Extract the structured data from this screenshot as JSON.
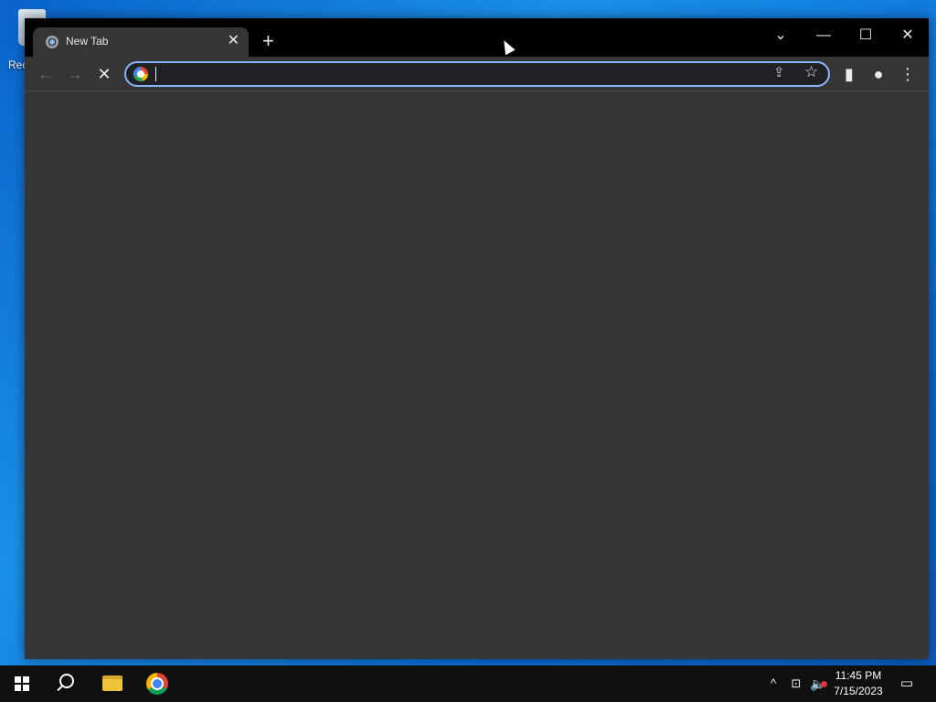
{
  "desktop": {
    "icons": [
      {
        "label": "Rec",
        "icon": "recycle-bin-icon"
      }
    ]
  },
  "browser": {
    "tabs": [
      {
        "title": "New Tab",
        "active": true,
        "icon": "chrome-newtab-icon"
      }
    ],
    "new_tab_symbol": "+",
    "window_controls": {
      "tab_search": "⌄",
      "minimize": "—",
      "maximize": "☐",
      "close": "✕"
    },
    "toolbar": {
      "back": "←",
      "forward": "→",
      "stop": "✕",
      "side_panel": "▮",
      "profile": "●",
      "menu": "⋮"
    },
    "omnibox": {
      "value": "",
      "placeholder": "",
      "share_icon": "⇪",
      "bookmark_icon": "☆"
    }
  },
  "taskbar": {
    "tray_arrow": "^",
    "network_icon": "⊡",
    "volume_icon": "🔈",
    "time": "11:45 PM",
    "date": "7/15/2023",
    "notifications_icon": "▭"
  },
  "colors": {
    "accent": "#8ab4f8",
    "content_background": "#353535",
    "titlebar": "#000000",
    "taskbar": "#101010"
  }
}
